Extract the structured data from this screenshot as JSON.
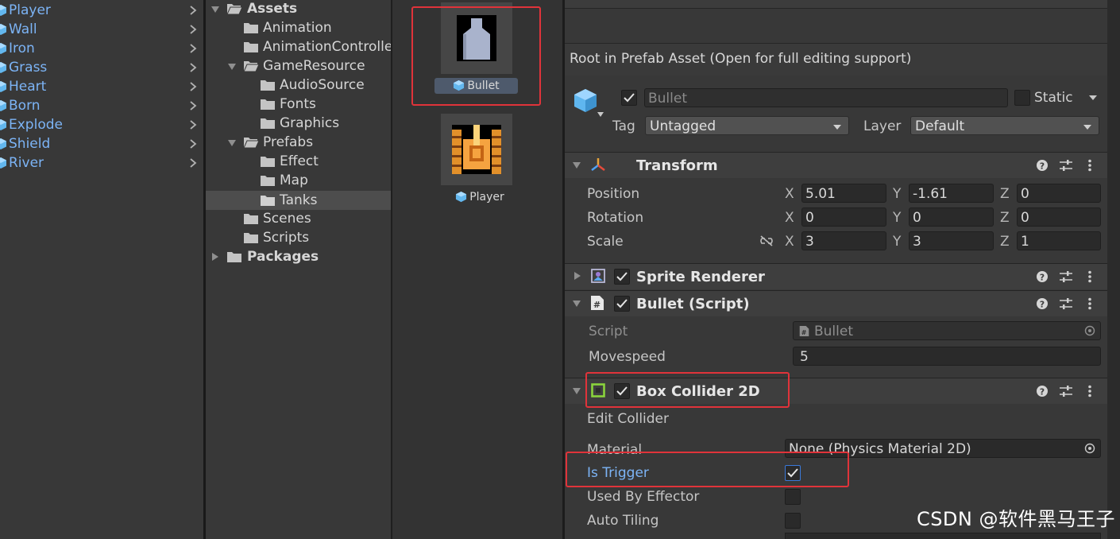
{
  "hierarchy": {
    "items": [
      {
        "label": "Player"
      },
      {
        "label": "Wall"
      },
      {
        "label": "Iron"
      },
      {
        "label": "Grass"
      },
      {
        "label": "Heart"
      },
      {
        "label": "Born"
      },
      {
        "label": "Explode"
      },
      {
        "label": "Shield"
      },
      {
        "label": "River"
      }
    ]
  },
  "project_tree": {
    "assets": "Assets",
    "animation": "Animation",
    "animation_controller": "AnimationController",
    "game_resource": "GameResource",
    "audio_source": "AudioSource",
    "fonts": "Fonts",
    "graphics": "Graphics",
    "prefabs": "Prefabs",
    "effect": "Effect",
    "map": "Map",
    "tanks": "Tanks",
    "scenes": "Scenes",
    "scripts": "Scripts",
    "packages": "Packages"
  },
  "asset_grid": {
    "bullet_label": "Bullet",
    "player_label": "Player"
  },
  "inspector": {
    "prefab_notice": "Root in Prefab Asset (Open for full editing support)",
    "object_name": "Bullet",
    "static_label": "Static",
    "tag_label": "Tag",
    "tag_value": "Untagged",
    "layer_label": "Layer",
    "layer_value": "Default",
    "transform": {
      "title": "Transform",
      "position_label": "Position",
      "rotation_label": "Rotation",
      "scale_label": "Scale",
      "x_axis": "X",
      "y_axis": "Y",
      "z_axis": "Z",
      "position": {
        "x": "5.01",
        "y": "-1.61",
        "z": "0"
      },
      "rotation": {
        "x": "0",
        "y": "0",
        "z": "0"
      },
      "scale": {
        "x": "3",
        "y": "3",
        "z": "1"
      }
    },
    "sprite_renderer": {
      "title": "Sprite Renderer"
    },
    "bullet_script": {
      "title": "Bullet (Script)",
      "script_label": "Script",
      "script_value": "Bullet",
      "movespeed_label": "Movespeed",
      "movespeed_value": "5"
    },
    "box_collider": {
      "title": "Box Collider 2D",
      "edit_collider": "Edit Collider",
      "material_label": "Material",
      "material_value": "None (Physics Material 2D)",
      "is_trigger_label": "Is Trigger",
      "is_trigger": true,
      "used_by_effector_label": "Used By Effector",
      "auto_tiling_label": "Auto Tiling"
    }
  },
  "watermark": "CSDN @软件黑马王子",
  "colors": {
    "highlight_red": "#e0333a",
    "link_blue": "#7cb4f6",
    "accent_blue": "#3a79d9"
  }
}
